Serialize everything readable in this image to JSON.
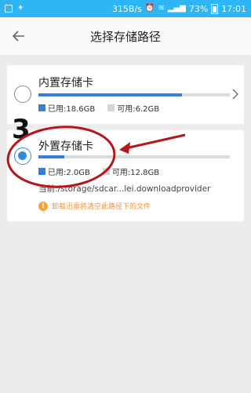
{
  "status_bar": {
    "network_speed": "315B/s",
    "battery": "73%",
    "time": "17:01"
  },
  "header": {
    "title": "选择存储路径"
  },
  "storage": {
    "internal": {
      "title": "内置存储卡",
      "used_label": "已用:18.6GB",
      "free_label": "可用:6.2GB",
      "used_fraction": 0.75,
      "selected": false
    },
    "external": {
      "title": "外置存储卡",
      "used_label": "已用:2.0GB",
      "free_label": "可用:12.8GB",
      "used_fraction": 0.135,
      "selected": true,
      "path": "当前:/storage/sdcar...lei.downloadprovider",
      "warning": "卸载迅雷将清空此路径下的文件"
    }
  },
  "annotation": {
    "step_number": "3"
  },
  "colors": {
    "status_bar": "#2db5f6",
    "accent": "#3a7dd8",
    "radio_selected": "#2d8ae6",
    "annotation_circle": "#b8161a",
    "warning": "#f5a23a"
  }
}
